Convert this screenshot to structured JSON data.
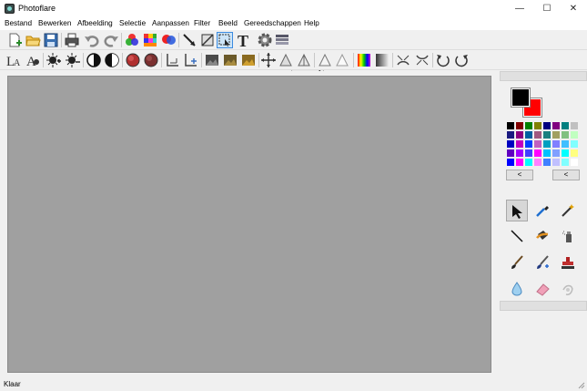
{
  "window": {
    "title": "Photoflare",
    "minimize_glyph": "—",
    "maximize_glyph": "☐",
    "close_glyph": "✕"
  },
  "menu": [
    {
      "label": "Bestand"
    },
    {
      "label": "Bewerken"
    },
    {
      "label": "Afbeelding"
    },
    {
      "label": "Selectie"
    },
    {
      "label": "Aanpassen"
    },
    {
      "label": "Filter"
    },
    {
      "label": "Beeld"
    },
    {
      "label": "Gereedschappen"
    },
    {
      "label": "Help"
    }
  ],
  "toolbar1": {
    "icons": [
      "new-file-icon",
      "open-folder-icon",
      "save-icon",
      "print-icon",
      "undo-icon",
      "redo-icon",
      "color-mix-icon",
      "color-grid-icon",
      "rgb-circles-icon",
      "line-arrow-icon",
      "crop-icon",
      "select-rect-icon",
      "text-icon",
      "gear-icon",
      "layers-icon"
    ],
    "zoom_value": ""
  },
  "toolbar2": {
    "icons": [
      "text-size-icon",
      "font-icon",
      "brightness-up-icon",
      "brightness-down-icon",
      "contrast-up-icon",
      "contrast-down-icon",
      "saturation-up-icon",
      "saturation-down-icon",
      "align-left-up-icon",
      "align-left-down-icon",
      "landscape-dark-icon",
      "landscape-mid-icon",
      "landscape-light-icon",
      "move-icon",
      "triangle-outline-icon",
      "triangle-split-icon",
      "triangle-empty-icon",
      "triangle-light-icon",
      "gradient-color-icon",
      "gradient-gray-icon",
      "flip-horizontal-icon",
      "flip-vertical-icon",
      "rotate-left-icon",
      "rotate-right-icon"
    ]
  },
  "colors": {
    "primary": "#000000",
    "secondary": "#ff0000",
    "palette": [
      "#000000",
      "#800000",
      "#008000",
      "#808000",
      "#000080",
      "#800080",
      "#008080",
      "#c0c0c0",
      "#1a1a80",
      "#8b0080",
      "#0060a0",
      "#a05a80",
      "#1a8080",
      "#a0a060",
      "#80c080",
      "#c0ffc0",
      "#0000c0",
      "#c000c0",
      "#0040ff",
      "#c060c0",
      "#00a0c0",
      "#8080ff",
      "#40c0ff",
      "#80ffff",
      "#6000c0",
      "#a000ff",
      "#4040ff",
      "#ff00ff",
      "#00c0ff",
      "#80a0ff",
      "#00ffff",
      "#ffff80",
      "#0000ff",
      "#ff00ff",
      "#00ffff",
      "#ff80ff",
      "#4080ff",
      "#c0c0ff",
      "#80ffff",
      "#ffffff"
    ],
    "prev_label": "<",
    "next_label": "<"
  },
  "tools": [
    {
      "name": "pointer-tool"
    },
    {
      "name": "eyedropper-tool"
    },
    {
      "name": "magic-wand-tool"
    },
    {
      "name": "line-tool"
    },
    {
      "name": "paint-bucket-tool"
    },
    {
      "name": "spray-tool"
    },
    {
      "name": "brush-tool"
    },
    {
      "name": "brush-plus-tool"
    },
    {
      "name": "stamp-tool"
    },
    {
      "name": "drop-tool"
    },
    {
      "name": "eraser-tool"
    },
    {
      "name": "smudge-tool"
    }
  ],
  "status": {
    "text": "Klaar"
  }
}
